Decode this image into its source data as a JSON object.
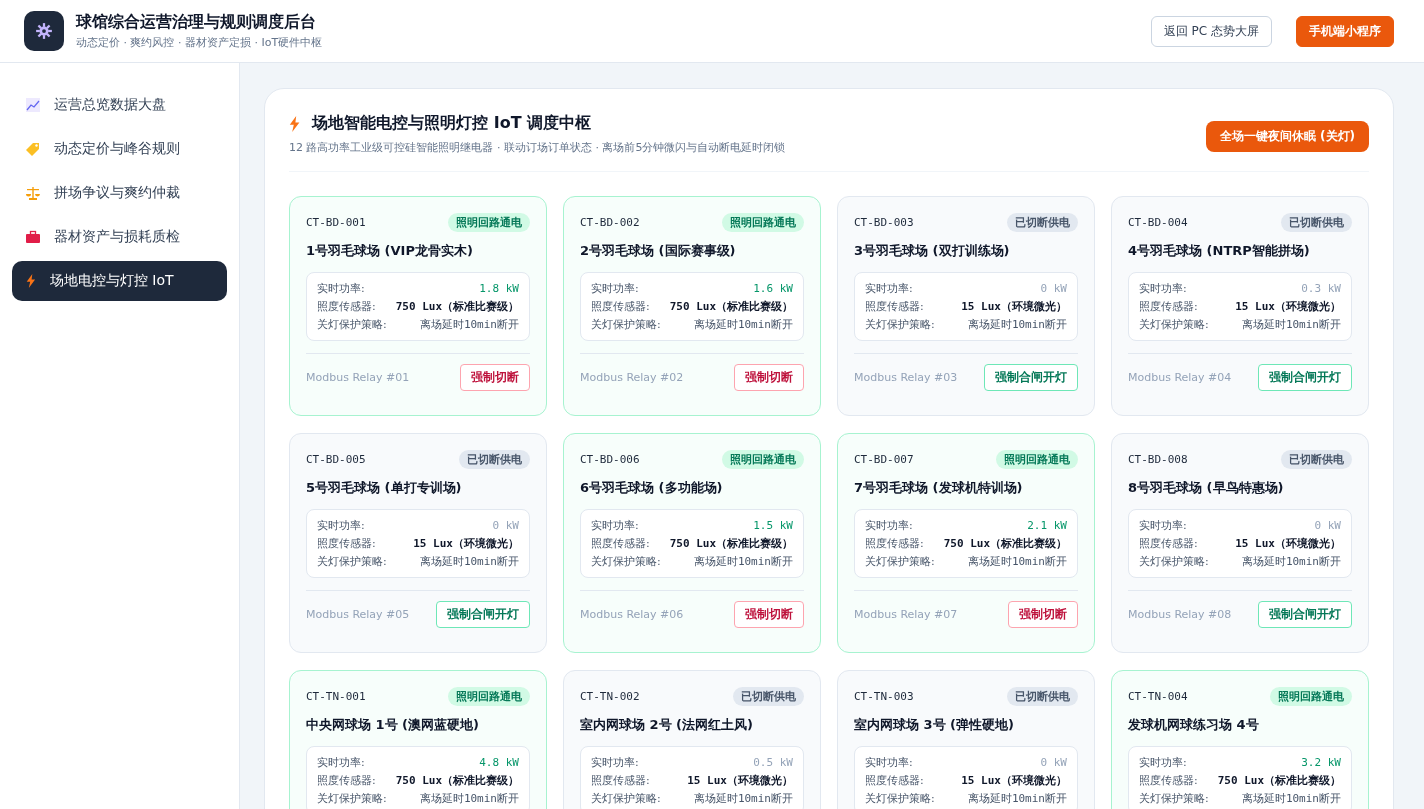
{
  "header": {
    "title": "球馆综合运营治理与规则调度后台",
    "subtitle": "动态定价 · 爽约风控 · 器材资产定损 · IoT硬件中枢",
    "buttons": [
      {
        "label": "返回 PC 态势大屏",
        "kind": "outline"
      },
      {
        "label": "手机端小程序",
        "kind": "primary"
      }
    ]
  },
  "sidebar": {
    "items": [
      {
        "label": "运营总览数据大盘",
        "selected": false
      },
      {
        "label": "动态定价与峰谷规则",
        "selected": false
      },
      {
        "label": "拼场争议与爽约仲裁",
        "selected": false
      },
      {
        "label": "器材资产与损耗质检",
        "selected": false
      },
      {
        "label": "场地电控与灯控 IoT",
        "selected": true
      }
    ]
  },
  "panel": {
    "title": "场地智能电控与照明灯控 IoT 调度中枢",
    "subtitle": "12 路高功率工业级可控硅智能照明继电器 · 联动订场订单状态 · 离场前5分钟微闪与自动断电延时闭锁",
    "action": "全场一键夜间休眠 (关灯)",
    "courts": [
      {
        "code": "CT-BD-001",
        "status": "照明回路通电",
        "powered": true,
        "name": "1号羽毛球场 (VIP龙骨实木)",
        "readings": [
          {
            "kind": "power",
            "label": "实时功率:",
            "value": "1.8 kW"
          },
          {
            "kind": "lux",
            "label": "照度传感器:",
            "value": "750 Lux（标准比赛级）"
          },
          {
            "kind": "policy",
            "label": "关灯保护策略:",
            "value": "离场延时10min断开"
          }
        ],
        "relay": "Modbus Relay #01",
        "button": "强制切断"
      },
      {
        "code": "CT-BD-002",
        "status": "照明回路通电",
        "powered": true,
        "name": "2号羽毛球场 (国际赛事级)",
        "readings": [
          {
            "kind": "power",
            "label": "实时功率:",
            "value": "1.6 kW"
          },
          {
            "kind": "lux",
            "label": "照度传感器:",
            "value": "750 Lux（标准比赛级）"
          },
          {
            "kind": "policy",
            "label": "关灯保护策略:",
            "value": "离场延时10min断开"
          }
        ],
        "relay": "Modbus Relay #02",
        "button": "强制切断"
      },
      {
        "code": "CT-BD-003",
        "status": "已切断供电",
        "powered": false,
        "name": "3号羽毛球场 (双打训练场)",
        "readings": [
          {
            "kind": "power",
            "label": "实时功率:",
            "value": "0 kW"
          },
          {
            "kind": "lux",
            "label": "照度传感器:",
            "value": "15 Lux（环境微光）"
          },
          {
            "kind": "policy",
            "label": "关灯保护策略:",
            "value": "离场延时10min断开"
          }
        ],
        "relay": "Modbus Relay #03",
        "button": "强制合闸开灯"
      },
      {
        "code": "CT-BD-004",
        "status": "已切断供电",
        "powered": false,
        "name": "4号羽毛球场 (NTRP智能拼场)",
        "readings": [
          {
            "kind": "power",
            "label": "实时功率:",
            "value": "0.3 kW"
          },
          {
            "kind": "lux",
            "label": "照度传感器:",
            "value": "15 Lux（环境微光）"
          },
          {
            "kind": "policy",
            "label": "关灯保护策略:",
            "value": "离场延时10min断开"
          }
        ],
        "relay": "Modbus Relay #04",
        "button": "强制合闸开灯"
      },
      {
        "code": "CT-BD-005",
        "status": "已切断供电",
        "powered": false,
        "name": "5号羽毛球场 (单打专训场)",
        "readings": [
          {
            "kind": "power",
            "label": "实时功率:",
            "value": "0 kW"
          },
          {
            "kind": "lux",
            "label": "照度传感器:",
            "value": "15 Lux（环境微光）"
          },
          {
            "kind": "policy",
            "label": "关灯保护策略:",
            "value": "离场延时10min断开"
          }
        ],
        "relay": "Modbus Relay #05",
        "button": "强制合闸开灯"
      },
      {
        "code": "CT-BD-006",
        "status": "照明回路通电",
        "powered": true,
        "name": "6号羽毛球场 (多功能场)",
        "readings": [
          {
            "kind": "power",
            "label": "实时功率:",
            "value": "1.5 kW"
          },
          {
            "kind": "lux",
            "label": "照度传感器:",
            "value": "750 Lux（标准比赛级）"
          },
          {
            "kind": "policy",
            "label": "关灯保护策略:",
            "value": "离场延时10min断开"
          }
        ],
        "relay": "Modbus Relay #06",
        "button": "强制切断"
      },
      {
        "code": "CT-BD-007",
        "status": "照明回路通电",
        "powered": true,
        "name": "7号羽毛球场 (发球机特训场)",
        "readings": [
          {
            "kind": "power",
            "label": "实时功率:",
            "value": "2.1 kW"
          },
          {
            "kind": "lux",
            "label": "照度传感器:",
            "value": "750 Lux（标准比赛级）"
          },
          {
            "kind": "policy",
            "label": "关灯保护策略:",
            "value": "离场延时10min断开"
          }
        ],
        "relay": "Modbus Relay #07",
        "button": "强制切断"
      },
      {
        "code": "CT-BD-008",
        "status": "已切断供电",
        "powered": false,
        "name": "8号羽毛球场 (早鸟特惠场)",
        "readings": [
          {
            "kind": "power",
            "label": "实时功率:",
            "value": "0 kW"
          },
          {
            "kind": "lux",
            "label": "照度传感器:",
            "value": "15 Lux（环境微光）"
          },
          {
            "kind": "policy",
            "label": "关灯保护策略:",
            "value": "离场延时10min断开"
          }
        ],
        "relay": "Modbus Relay #08",
        "button": "强制合闸开灯"
      },
      {
        "code": "CT-TN-001",
        "status": "照明回路通电",
        "powered": true,
        "name": "中央网球场 1号 (澳网蓝硬地)",
        "readings": [
          {
            "kind": "power",
            "label": "实时功率:",
            "value": "4.8 kW"
          },
          {
            "kind": "lux",
            "label": "照度传感器:",
            "value": "750 Lux（标准比赛级）"
          },
          {
            "kind": "policy",
            "label": "关灯保护策略:",
            "value": "离场延时10min断开"
          }
        ]
      },
      {
        "code": "CT-TN-002",
        "status": "已切断供电",
        "powered": false,
        "name": "室内网球场 2号 (法网红土风)",
        "readings": [
          {
            "kind": "power",
            "label": "实时功率:",
            "value": "0.5 kW"
          },
          {
            "kind": "lux",
            "label": "照度传感器:",
            "value": "15 Lux（环境微光）"
          },
          {
            "kind": "policy",
            "label": "关灯保护策略:",
            "value": "离场延时10min断开"
          }
        ]
      },
      {
        "code": "CT-TN-003",
        "status": "已切断供电",
        "powered": false,
        "name": "室内网球场 3号 (弹性硬地)",
        "readings": [
          {
            "kind": "power",
            "label": "实时功率:",
            "value": "0 kW"
          },
          {
            "kind": "lux",
            "label": "照度传感器:",
            "value": "15 Lux（环境微光）"
          },
          {
            "kind": "policy",
            "label": "关灯保护策略:",
            "value": "离场延时10min断开"
          }
        ]
      },
      {
        "code": "CT-TN-004",
        "status": "照明回路通电",
        "powered": true,
        "name": "发球机网球练习场 4号",
        "readings": [
          {
            "kind": "power",
            "label": "实时功率:",
            "value": "3.2 kW"
          },
          {
            "kind": "lux",
            "label": "照度传感器:",
            "value": "750 Lux（标准比赛级）"
          },
          {
            "kind": "policy",
            "label": "关灯保护策略:",
            "value": "离场延时10min断开"
          }
        ]
      }
    ]
  }
}
